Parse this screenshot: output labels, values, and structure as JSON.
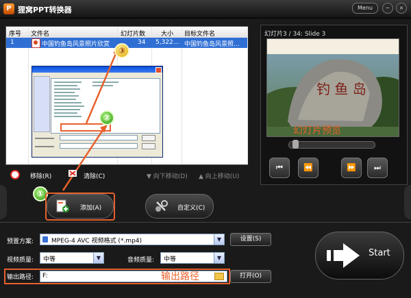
{
  "window": {
    "title": "狸窝PPT转换器",
    "menu_label": "Menu",
    "app_icon_glyph": "P",
    "minimize_symbol": "−",
    "close_symbol": "×"
  },
  "file_list": {
    "columns": [
      "序号",
      "文件名",
      "幻灯片数",
      "大小",
      "目标文件名"
    ],
    "rows": [
      {
        "index": "1",
        "filename": "中国钓鱼岛风景照片欣赏",
        "slides": "34",
        "size": "5,322...",
        "target": "中国钓鱼岛风景照..."
      }
    ]
  },
  "annotations": {
    "marker_1": "①",
    "marker_2": "②",
    "marker_3": "③",
    "preview_label": "幻灯片预览",
    "output_label": "输出路径"
  },
  "list_actions": {
    "remove": "移除(R)",
    "clear": "清除(C)",
    "move_down": "向下移动(D)",
    "move_up": "向上移动(U)"
  },
  "buttons": {
    "add": "添加(A)",
    "custom": "自定义(C)",
    "settings": "设置(S)",
    "open": "打开(O)",
    "start": "Start"
  },
  "preview": {
    "caption": "幻灯片3 / 34: Slide 3",
    "controls": [
      "⏮",
      "⏪",
      "⏩",
      "⏭"
    ],
    "progress": 0.03
  },
  "settings": {
    "preset_label": "预置方案:",
    "preset_value": "MPEG-4 AVC 视频格式 (*.mp4)",
    "video_quality_label": "视频质量:",
    "video_quality_value": "中等",
    "audio_quality_label": "音频质量:",
    "audio_quality_value": "中等",
    "output_label": "输出路径:",
    "output_value": "F:"
  },
  "colors": {
    "accent": "#e8602c",
    "selection": "#2f6fd4",
    "background": "#1a1a1a"
  }
}
